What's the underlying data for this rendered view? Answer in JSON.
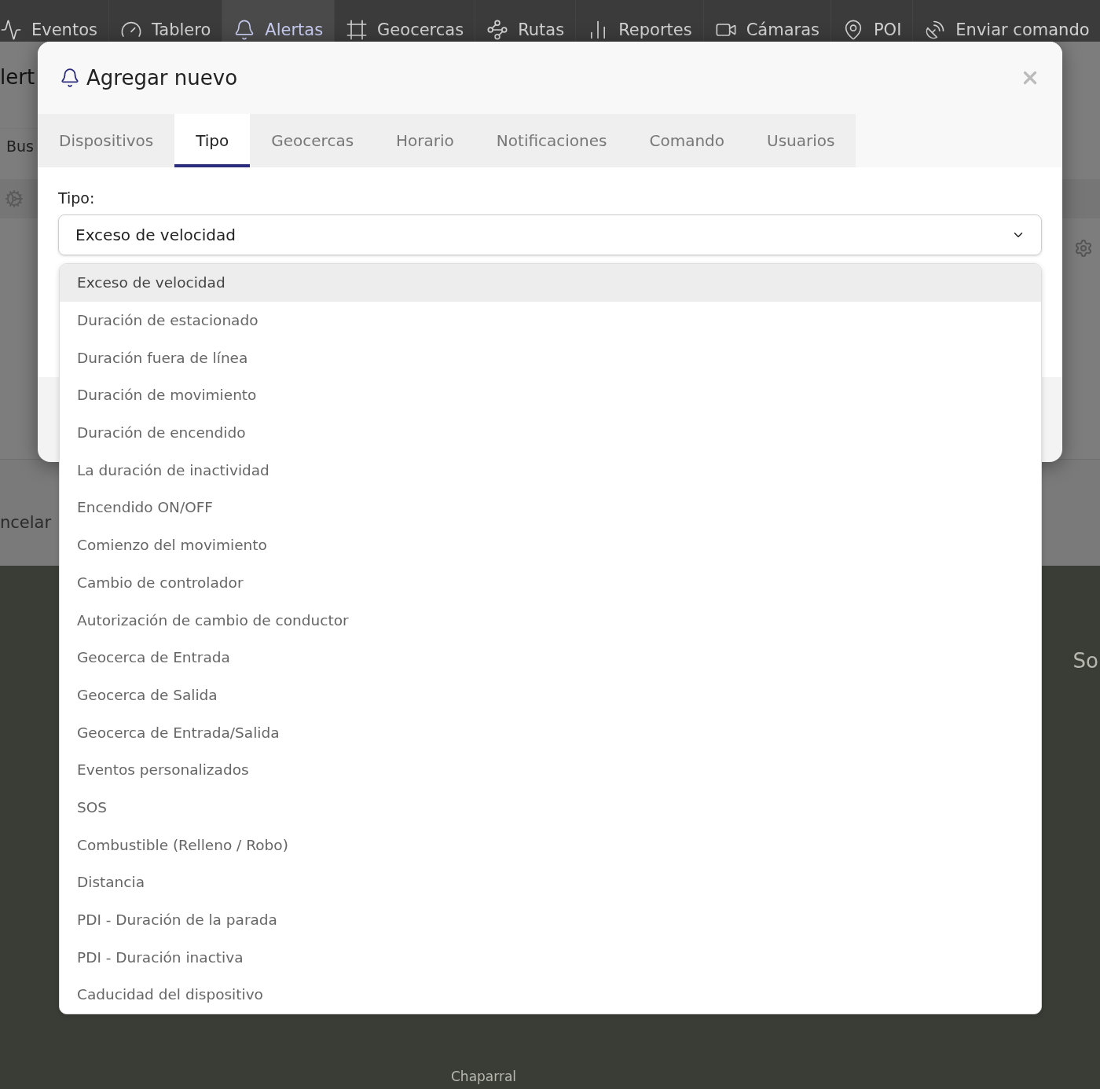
{
  "nav": {
    "items": [
      {
        "label": "Eventos",
        "selected": false
      },
      {
        "label": "Tablero",
        "selected": false
      },
      {
        "label": "Alertas",
        "selected": true
      },
      {
        "label": "Geocercas",
        "selected": false
      },
      {
        "label": "Rutas",
        "selected": false
      },
      {
        "label": "Reportes",
        "selected": false
      },
      {
        "label": "Cámaras",
        "selected": false
      },
      {
        "label": "POI",
        "selected": false
      },
      {
        "label": "Enviar comando",
        "selected": false
      }
    ]
  },
  "background": {
    "title": "lert",
    "search_placeholder": "Bus",
    "cancel_button": "ncelar",
    "map_labels": [
      "So",
      "Chaparral"
    ]
  },
  "modal": {
    "title": "Agregar nuevo",
    "tabs": [
      {
        "label": "Dispositivos",
        "selected": false
      },
      {
        "label": "Tipo",
        "selected": true
      },
      {
        "label": "Geocercas",
        "selected": false
      },
      {
        "label": "Horario",
        "selected": false
      },
      {
        "label": "Notificaciones",
        "selected": false
      },
      {
        "label": "Comando",
        "selected": false
      },
      {
        "label": "Usuarios",
        "selected": false
      }
    ],
    "field_label": "Tipo:",
    "select_value": "Exceso de velocidad",
    "options": [
      {
        "label": "Exceso de velocidad",
        "selected": true
      },
      {
        "label": "Duración de estacionado",
        "selected": false
      },
      {
        "label": "Duración fuera de línea",
        "selected": false
      },
      {
        "label": "Duración de movimiento",
        "selected": false
      },
      {
        "label": "Duración de encendido",
        "selected": false
      },
      {
        "label": "La duración de inactividad",
        "selected": false
      },
      {
        "label": "Encendido ON/OFF",
        "selected": false
      },
      {
        "label": "Comienzo del movimiento",
        "selected": false
      },
      {
        "label": "Cambio de controlador",
        "selected": false
      },
      {
        "label": "Autorización de cambio de conductor",
        "selected": false
      },
      {
        "label": "Geocerca de Entrada",
        "selected": false
      },
      {
        "label": "Geocerca de Salida",
        "selected": false
      },
      {
        "label": "Geocerca de Entrada/Salida",
        "selected": false
      },
      {
        "label": "Eventos personalizados",
        "selected": false
      },
      {
        "label": "SOS",
        "selected": false
      },
      {
        "label": "Combustible (Relleno / Robo)",
        "selected": false
      },
      {
        "label": "Distancia",
        "selected": false
      },
      {
        "label": "PDI - Duración de la parada",
        "selected": false
      },
      {
        "label": "PDI - Duración inactiva",
        "selected": false
      },
      {
        "label": "Caducidad del dispositivo",
        "selected": false
      }
    ]
  }
}
